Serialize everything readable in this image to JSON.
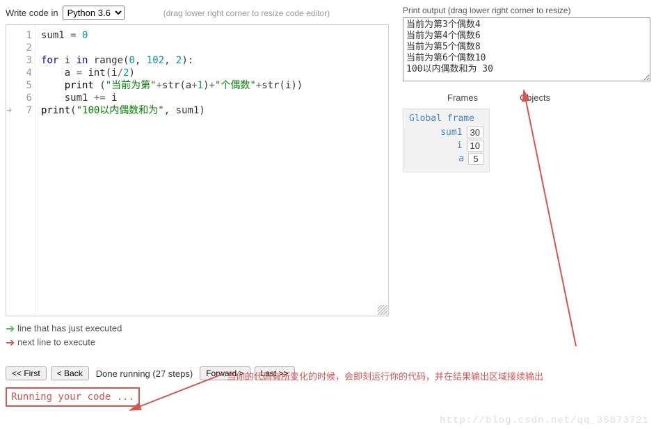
{
  "header": {
    "write_label": "Write code in",
    "language": "Python 3.6",
    "hint": "(drag lower right corner to resize code editor)"
  },
  "editor": {
    "gutter": [
      "1",
      "2",
      "3",
      "4",
      "5",
      "6",
      "7"
    ],
    "gutter_arrow_line": 7,
    "code_lines": [
      {
        "tokens": [
          {
            "t": "sum1 ",
            "c": ""
          },
          {
            "t": "=",
            "c": "op"
          },
          {
            "t": " ",
            "c": ""
          },
          {
            "t": "0",
            "c": "num"
          }
        ]
      },
      {
        "tokens": []
      },
      {
        "tokens": [
          {
            "t": "for",
            "c": "kw"
          },
          {
            "t": " i ",
            "c": ""
          },
          {
            "t": "in",
            "c": "kw"
          },
          {
            "t": " range(",
            "c": ""
          },
          {
            "t": "0",
            "c": "num"
          },
          {
            "t": ", ",
            "c": ""
          },
          {
            "t": "102",
            "c": "num"
          },
          {
            "t": ", ",
            "c": ""
          },
          {
            "t": "2",
            "c": "num"
          },
          {
            "t": "):",
            "c": ""
          }
        ]
      },
      {
        "tokens": [
          {
            "t": "    a ",
            "c": ""
          },
          {
            "t": "=",
            "c": "op"
          },
          {
            "t": " int(i",
            "c": ""
          },
          {
            "t": "/",
            "c": "op"
          },
          {
            "t": "2",
            "c": "num"
          },
          {
            "t": ")",
            "c": ""
          }
        ]
      },
      {
        "tokens": [
          {
            "t": "    ",
            "c": ""
          },
          {
            "t": "print",
            "c": "fn"
          },
          {
            "t": " (",
            "c": ""
          },
          {
            "t": "\"当前为第\"",
            "c": "str"
          },
          {
            "t": "+",
            "c": "op"
          },
          {
            "t": "str(a",
            "c": ""
          },
          {
            "t": "+",
            "c": "op"
          },
          {
            "t": "1",
            "c": "num"
          },
          {
            "t": ")",
            "c": ""
          },
          {
            "t": "+",
            "c": "op"
          },
          {
            "t": "\"个偶数\"",
            "c": "str"
          },
          {
            "t": "+",
            "c": "op"
          },
          {
            "t": "str(i))",
            "c": ""
          }
        ]
      },
      {
        "tokens": [
          {
            "t": "    sum1 ",
            "c": ""
          },
          {
            "t": "+=",
            "c": "op"
          },
          {
            "t": " i",
            "c": ""
          }
        ]
      },
      {
        "tokens": [
          {
            "t": "print",
            "c": "fn"
          },
          {
            "t": "(",
            "c": ""
          },
          {
            "t": "\"100以内偶数和为\"",
            "c": "str"
          },
          {
            "t": ", sum1)",
            "c": ""
          }
        ]
      }
    ]
  },
  "legend": {
    "executed": "line that has just executed",
    "next": "next line to execute"
  },
  "controls": {
    "first": "<< First",
    "back": "< Back",
    "done": "Done running (27 steps)",
    "forward": "Forward >",
    "last": "Last >>"
  },
  "running": "Running your code ...",
  "output": {
    "label": "Print output (drag lower right corner to resize)",
    "lines": [
      "当前为第3个偶数4",
      "当前为第4个偶数6",
      "当前为第5个偶数8",
      "当前为第6个偶数10",
      "100以内偶数和为 30"
    ]
  },
  "frames": {
    "frames_label": "Frames",
    "objects_label": "Objects",
    "global_title": "Global frame",
    "vars": [
      {
        "name": "sum1",
        "value": "30"
      },
      {
        "name": "i",
        "value": "10"
      },
      {
        "name": "a",
        "value": "5"
      }
    ]
  },
  "annotation": "当你的代码有所变化的时候，会即刻运行你的代码，并在结果输出区域接续输出",
  "watermark": "http://blog.csdn.net/qq_35873721"
}
